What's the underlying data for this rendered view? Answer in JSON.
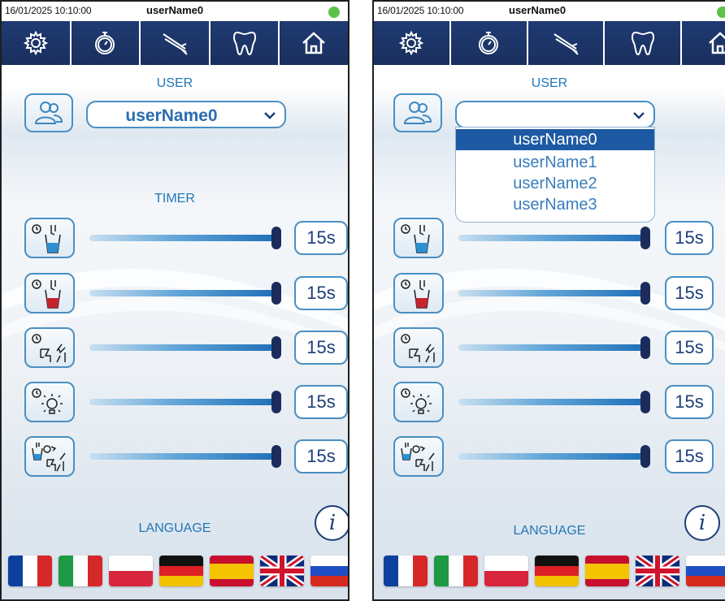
{
  "status": {
    "datetime": "16/01/2025 10:10:00",
    "user": "userName0",
    "indicator_color": "#5bc24a"
  },
  "toolbar": {
    "items": [
      {
        "name": "gear-icon",
        "interactable": true
      },
      {
        "name": "stopwatch-icon",
        "interactable": true
      },
      {
        "name": "dental-instruments-icon",
        "interactable": true
      },
      {
        "name": "tooth-icon",
        "interactable": true
      },
      {
        "name": "home-icon",
        "interactable": true
      }
    ],
    "bg_color": "#1f3b73"
  },
  "user_section": {
    "title": "USER",
    "selected_user": "userName0",
    "options": [
      "userName0",
      "userName1",
      "userName2",
      "userName3"
    ],
    "dropdown_open_right_screen": true
  },
  "timer_section": {
    "title": "TIMER",
    "rows": [
      {
        "icon": "cup-blue-timer-icon",
        "value": "15s",
        "level": 1.0
      },
      {
        "icon": "cup-red-timer-icon",
        "value": "15s",
        "level": 1.0
      },
      {
        "icon": "spittoon-timer-icon",
        "value": "15s",
        "level": 1.0
      },
      {
        "icon": "lamp-timer-icon",
        "value": "15s",
        "level": 1.0
      },
      {
        "icon": "cup-spittoon-cycle-timer-icon",
        "value": "15s",
        "level": 1.0
      }
    ]
  },
  "language_section": {
    "title": "LANGUAGE",
    "info_label": "i",
    "flags": [
      "flag-france-icon",
      "flag-italy-icon",
      "flag-poland-icon",
      "flag-germany-icon",
      "flag-spain-icon",
      "flag-uk-icon",
      "flag-russia-icon"
    ]
  },
  "colors": {
    "accent": "#2277b7",
    "dark_navy": "#1b2c5c",
    "selection": "#1d5aa3"
  }
}
